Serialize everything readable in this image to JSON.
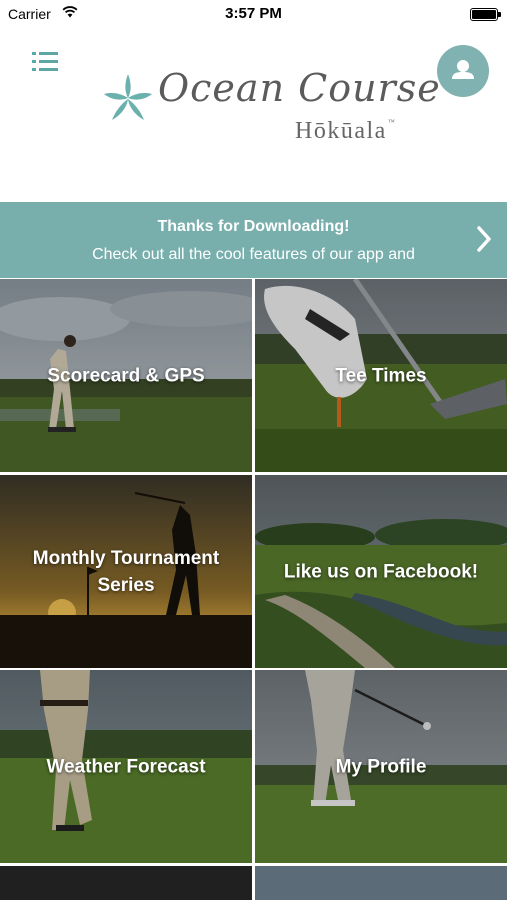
{
  "status_bar": {
    "carrier": "Carrier",
    "time": "3:57 PM"
  },
  "header": {
    "logo_title": "Ocean Course",
    "logo_subtitle": "Hōkūala",
    "logo_tm": "™",
    "menu_icon": "list-icon",
    "profile_icon": "user-icon"
  },
  "banner": {
    "title": "Thanks for Downloading!",
    "text": "Check out all the cool features of our app and",
    "arrow_icon": "chevron-right-icon"
  },
  "tiles": [
    {
      "label": "Scorecard & GPS"
    },
    {
      "label": "Tee Times"
    },
    {
      "label": "Monthly Tournament Series"
    },
    {
      "label": "Like us on Facebook!"
    },
    {
      "label": "Weather Forecast"
    },
    {
      "label": "My Profile"
    }
  ],
  "colors": {
    "brand_teal": "#78afad",
    "profile_teal": "#7fb2b0",
    "menu_icon": "#5ca6a5"
  }
}
